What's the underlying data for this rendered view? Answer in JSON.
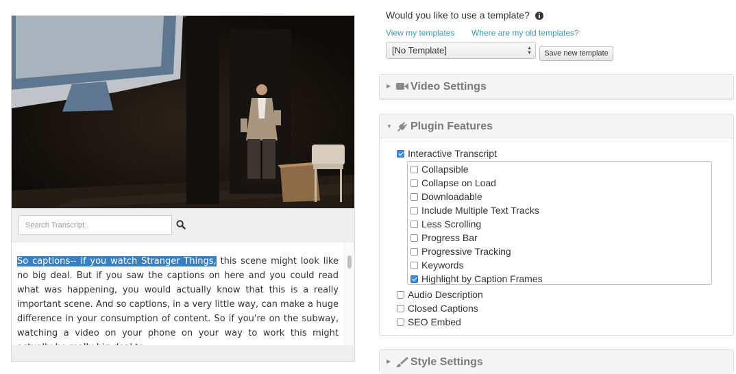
{
  "search": {
    "placeholder": "Search Transcript.."
  },
  "transcript": {
    "highlighted": "So captions-- if you watch Stranger Things,",
    "text": " this scene might look like no big deal. But if you saw the captions on here and you could read what was happening, you would actually know that this is a really important scene. And so captions, in a very little way, can make a huge difference in your consumption of content. So if you're on the subway, watching a video on your phone on your way to work this might actually be really big deal to"
  },
  "template": {
    "question": "Would you like to use a template?",
    "view_link": "View my templates",
    "old_link": "Where are my old templates?",
    "selected": "[No Template]",
    "save_button": "Save new template"
  },
  "panels": {
    "video_settings": {
      "title": "Video Settings",
      "icon": "video-camera-icon"
    },
    "plugin_features": {
      "title": "Plugin Features",
      "icon": "plug-icon"
    },
    "style_settings": {
      "title": "Style Settings",
      "icon": "paintbrush-icon"
    }
  },
  "features": {
    "interactive_transcript": {
      "label": "Interactive Transcript",
      "checked": true
    },
    "sub_options": [
      {
        "label": "Collapsible",
        "checked": false
      },
      {
        "label": "Collapse on Load",
        "checked": false
      },
      {
        "label": "Downloadable",
        "checked": false
      },
      {
        "label": "Include Multiple Text Tracks",
        "checked": false
      },
      {
        "label": "Less Scrolling",
        "checked": false
      },
      {
        "label": "Progress Bar",
        "checked": false
      },
      {
        "label": "Progressive Tracking",
        "checked": false
      },
      {
        "label": "Keywords",
        "checked": false
      },
      {
        "label": "Highlight by Caption Frames",
        "checked": true
      }
    ],
    "others": [
      {
        "label": "Audio Description",
        "checked": false
      },
      {
        "label": "Closed Captions",
        "checked": false
      },
      {
        "label": "SEO Embed",
        "checked": false
      }
    ]
  },
  "colors": {
    "link": "#3d9bb7",
    "highlight": "#3a7fc0",
    "checkbox": "#3a8ee6"
  }
}
